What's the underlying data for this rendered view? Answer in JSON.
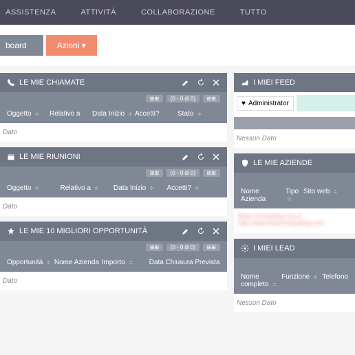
{
  "nav": {
    "items": [
      "ASSISTENZA",
      "ATTIVITÀ",
      "COLLABORAZIONE",
      "TUTTO"
    ]
  },
  "toolbar": {
    "board_label": "board",
    "azioni_label": "Azioni ▾"
  },
  "panels": {
    "chiamate": {
      "title": "LE MIE CHIAMATE",
      "stats": "(0 - 0 di 0)",
      "cols": [
        "Oggetto",
        "Relativo a",
        "Data Inizio",
        "Accetti?",
        "Stato"
      ],
      "nodata": "Dato"
    },
    "riunioni": {
      "title": "LE MIE RIUNIONI",
      "stats": "(0 - 0 di 0)",
      "cols": [
        "Oggetto",
        "Relativo a",
        "Data Inizio",
        "Accetti?"
      ],
      "nodata": "Dato"
    },
    "opportunita": {
      "title": "LE MIE 10 MIGLIORI OPPORTUNITÀ",
      "stats": "(0 - 0 di 0)",
      "cols": [
        "Opportunità",
        "Nome Azienda",
        "Importo",
        "Data Chiusura Prevista"
      ],
      "nodata": "Dato"
    },
    "feed": {
      "title": "I MIEI FEED",
      "admin": "Administrator",
      "nodata": "Nessun Dato"
    },
    "aziende": {
      "title": "LE MIE AZIENDE",
      "cols": [
        "Nome Azienda",
        "Tipo",
        "Sito web"
      ]
    },
    "lead": {
      "title": "I MIEI LEAD",
      "cols": [
        "Nome completo",
        "Funzione",
        "Telefono"
      ],
      "nodata": "Nessun Dato"
    }
  }
}
